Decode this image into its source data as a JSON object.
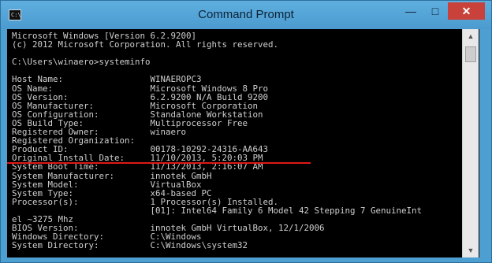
{
  "window": {
    "title": "Command Prompt",
    "icon_text": "C:\\",
    "minimize_icon": "minimize-icon",
    "maximize_icon": "maximize-icon",
    "close_icon": "close-icon"
  },
  "console": {
    "lines": [
      "Microsoft Windows [Version 6.2.9200]",
      "(c) 2012 Microsoft Corporation. All rights reserved.",
      "",
      "C:\\Users\\winaero>systeminfo",
      "",
      "Host Name:                 WINAEROPC3",
      "OS Name:                   Microsoft Windows 8 Pro",
      "OS Version:                6.2.9200 N/A Build 9200",
      "OS Manufacturer:           Microsoft Corporation",
      "OS Configuration:          Standalone Workstation",
      "OS Build Type:             Multiprocessor Free",
      "Registered Owner:          winaero",
      "Registered Organization:",
      "Product ID:                00178-10292-24316-AA643",
      "Original Install Date:     11/10/2013, 5:20:03 PM",
      "System Boot Time:          11/13/2013, 2:16:07 AM",
      "System Manufacturer:       innotek GmbH",
      "System Model:              VirtualBox",
      "System Type:               x64-based PC",
      "Processor(s):              1 Processor(s) Installed.",
      "                           [01]: Intel64 Family 6 Model 42 Stepping 7 GenuineInt",
      "el ~3275 Mhz",
      "BIOS Version:              innotek GmbH VirtualBox, 12/1/2006",
      "Windows Directory:         C:\\Windows",
      "System Directory:          C:\\Windows\\system32"
    ]
  },
  "colors": {
    "console_text": "#cfcfcf",
    "console_bg": "#000000",
    "window_frame": "#4d9fd1",
    "close_button": "#c8413a",
    "highlight_line": "#e01818"
  }
}
